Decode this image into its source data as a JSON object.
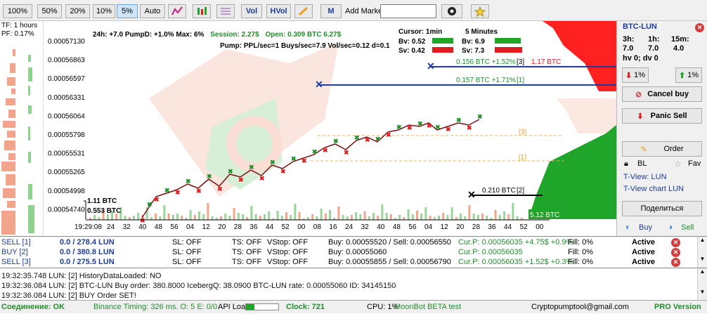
{
  "toolbar": {
    "btn_100": "100%",
    "btn_50": "50%",
    "btn_20": "20%",
    "btn_10": "10%",
    "btn_5": "5%",
    "btn_auto": "Auto",
    "btn_vol": "Vol",
    "btn_hvol": "HVol",
    "btn_m": "M",
    "market_label": "Add Market BTC-",
    "market_value": ""
  },
  "left_panel": {
    "tf": "TF: 1 hours",
    "pf": "PF: 0.17%"
  },
  "chart": {
    "info_line": "24h: +7.0  PumpD: +1.0%  Max: 6%",
    "session": "Session: 2.27$",
    "open": "Open: 0.309 BTC  6.27$",
    "pump_line": "Pump: PPL/sec=1 Buys/sec=7.9  Vol/sec=0.12  d=0.1",
    "cursor_title": "Cursor: 1min",
    "cursor_bv": "Bv: 0.52",
    "cursor_sv": "Sv: 0.42",
    "five_title": "5 Minutes",
    "five_bv": "Bv: 6.9",
    "five_sv": "Sv: 7.3",
    "price_labels": [
      "0.00057130",
      "0.00056863",
      "0.00056597",
      "0.00056331",
      "0.00056064",
      "0.00055798",
      "0.00055531",
      "0.00055265",
      "0.00054998",
      "0.00054740"
    ],
    "time_labels": [
      "19:29:08",
      "24",
      "32",
      "40",
      "48",
      "56",
      "04",
      "12",
      "20",
      "28",
      "36",
      "44",
      "52",
      "00",
      "08",
      "16",
      "24",
      "32",
      "40",
      "48",
      "56",
      "04",
      "12",
      "20",
      "28",
      "36",
      "44",
      "52",
      "00"
    ],
    "order3_label": "0.156 BTC +1.52%",
    "order3_tag": "[3]",
    "order3_red": "1.17 BTC",
    "order1_label": "0.157 BTC +1.71%",
    "order1_tag": "[1]",
    "level3_tag": "[3]",
    "level1_tag": "[1]",
    "order2_label": "0.210 BTC",
    "order2_tag": "[2]",
    "vol_label_1": "1.11 BTC",
    "vol_label_2": "0.553 BTC",
    "depth_label": "5.12 BTC"
  },
  "right_panel": {
    "title": "BTC-LUN",
    "col1": "3h:",
    "col2": "1h:",
    "col3": "15m:",
    "v1": "7.0",
    "v2": "7.0",
    "v3": "4.0",
    "hv": "hv 0; dv 0",
    "down_pct": "1%",
    "up_pct": "1%",
    "cancel_buy": "Cancel buy",
    "panic_sell": "Panic Sell",
    "order": "Order",
    "bl": "BL",
    "fav": "Fav",
    "tview": "T-View: LUN",
    "tview_chart": "T-View chart LUN",
    "share": "Поделиться",
    "buy": "Buy",
    "sell": "Sell"
  },
  "orders": [
    {
      "id": "SELL [1]",
      "amount": "0.0 / 278.4 LUN",
      "sl": "SL: OFF",
      "ts": "TS: OFF",
      "vstop": "VStop: OFF",
      "prices": "Buy: 0.00055520 / Sell: 0.00056550",
      "cur": "Cur.P: 0.00056035  +4.75$ +0.9%",
      "fill": "Fill: 0%",
      "status": "Active"
    },
    {
      "id": "BUY [2]",
      "amount": "0.0 / 380.8 LUN",
      "sl": "SL: OFF",
      "ts": "TS: OFF",
      "vstop": "VStop: OFF",
      "prices": "Buy: 0.00055060",
      "cur": "Cur.P: 0.00056035",
      "fill": "Fill: 0%",
      "status": "Active"
    },
    {
      "id": "SELL [3]",
      "amount": "0.0 / 275.5 LUN",
      "sl": "SL: OFF",
      "ts": "TS: OFF",
      "vstop": "VStop: OFF",
      "prices": "Buy: 0.00055855 / Sell: 0.00056790",
      "cur": "Cur.P: 0.00056035  +1.52$ +0.3%",
      "fill": "Fill: 0%",
      "status": "Active"
    }
  ],
  "log": [
    "19:32:35.748  LUN: [2]  HistoryDataLoaded: NO",
    "19:32:36.084  LUN: [2] BTC-LUN Buy order: 380.8000 IcebergQ: 38.0900 BTC-LUN rate: 0.00055060  ID: 34145150",
    "19:32:36.084  LUN: [2] BUY Order SET!"
  ],
  "status": {
    "conn": "Соединение: OK",
    "timing": "Binance Timing: 326 ms.  O: 5  E: 0/0",
    "apiload": "API Load",
    "clock": "Clock: 721",
    "cpu": "CPU: 1%",
    "beta": "MoonBot BETA test",
    "email": "Cryptopumptool@gmail.com",
    "pro": "PRO Version"
  },
  "colors": {
    "buy": "#1f8f2a",
    "sell": "#e01c1c",
    "accent": "#1e3c9c",
    "depth_red": "#ff2020",
    "depth_green": "#1fa52a"
  }
}
